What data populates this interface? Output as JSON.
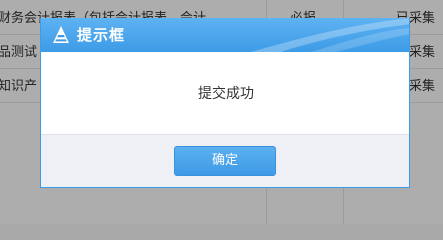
{
  "background": {
    "rows": [
      {
        "c1": "财务会计报表（包括会计报表、会计",
        "c2": "必报",
        "c3": "已采集"
      },
      {
        "c1": "品测试",
        "c2": "",
        "c3": "已采集"
      },
      {
        "c1": "知识产",
        "c2": "",
        "c3": "已采集"
      }
    ]
  },
  "dialog": {
    "title": "提示框",
    "title_icon": "warning-cone-icon",
    "message": "提交成功",
    "ok_label": "确定"
  },
  "colors": {
    "header_blue": "#4aa5ed",
    "button_blue": "#4ba6ec",
    "footer_bg": "#eef0f5"
  }
}
